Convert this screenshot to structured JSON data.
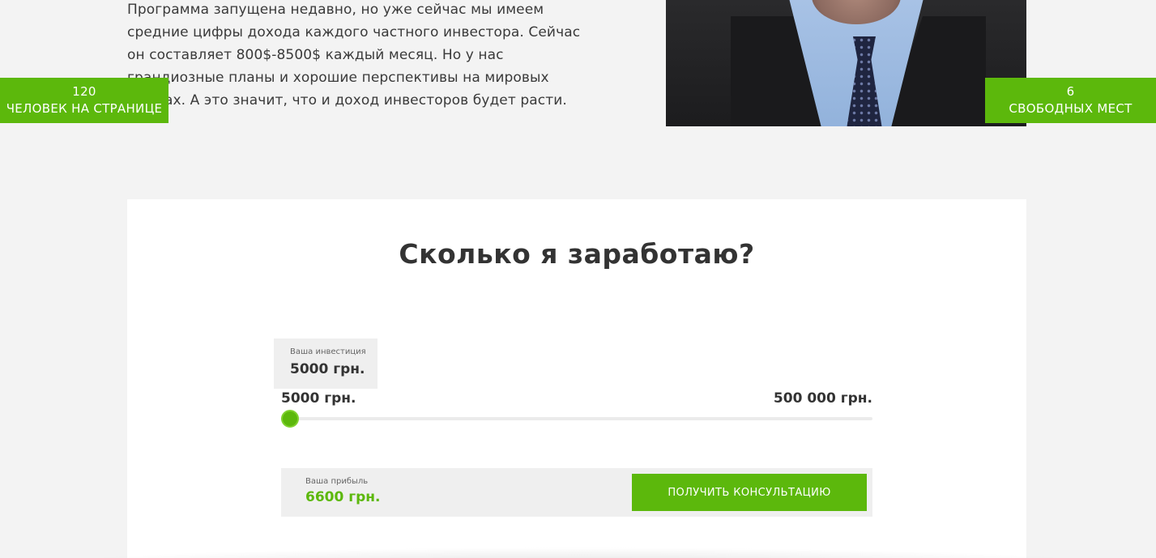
{
  "intro": {
    "text": "Программа запущена недавно, но уже сейчас мы имеем средние цифры дохода каждого частного инвестора. Сейчас он составляет 800$-8500$ каждый месяц. Но у нас грандиозные планы и хорошие перспективы на мировых рынках. А это значит, что и доход инвесторов будет расти."
  },
  "badges": {
    "left": {
      "count": "120",
      "label": "ЧЕЛОВЕК НА СТРАНИЦЕ"
    },
    "right": {
      "count": "6",
      "label": "СВОБОДНЫХ МЕСТ"
    }
  },
  "calculator": {
    "title": "Сколько я заработаю?",
    "investment_label": "Ваша инвестиция",
    "investment_value": "5000 грн.",
    "range_min": "5000 грн.",
    "range_max": "500 000 грн.",
    "slider_position": 0.0,
    "profit_label": "Ваша прибыль",
    "profit_value": "6600 грн.",
    "cta_label": "ПОЛУЧИТЬ КОНСУЛЬТАЦИЮ"
  },
  "colors": {
    "accent": "#5cb80c",
    "page_bg": "#f3f3f3",
    "card_bg": "#ffffff",
    "box_bg": "#efefef"
  }
}
